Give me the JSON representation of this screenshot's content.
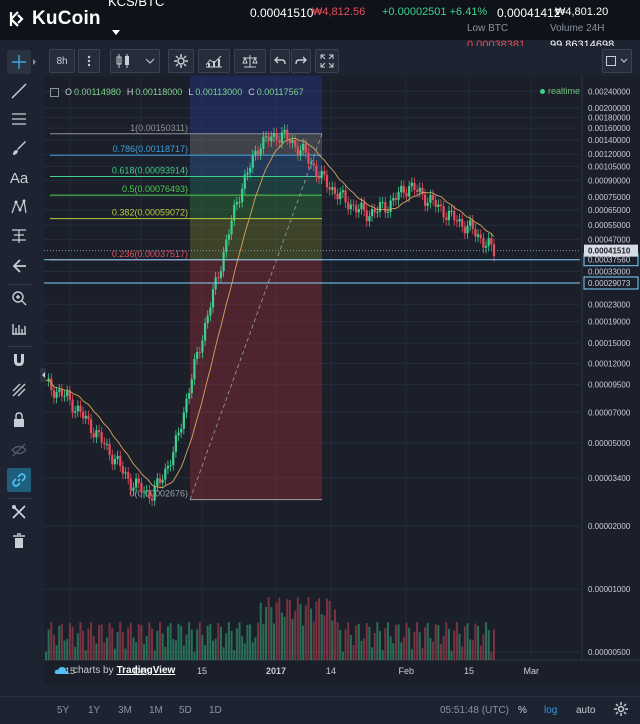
{
  "header": {
    "logo_text": "KuCoin",
    "pair": "KCS/BTC",
    "last_price": "0.00041510",
    "last_price_krw": "₩4,812.56",
    "change": "+0.00002501 +6.41%",
    "high_price": "0.00041412",
    "high_price_krw": "₩4,801.20",
    "low_label": "Low BTC",
    "low_value": "0.00038381",
    "volume_label": "Volume 24H",
    "volume_value": "99.86314698"
  },
  "toolbar": {
    "interval": "8h",
    "icons": [
      "more-icon",
      "candlestick-icon",
      "chevron-down-icon",
      "gear-icon",
      "indicators-icon",
      "compare-icon",
      "undo-icon",
      "redo-icon",
      "fullscreen-icon",
      "color-swatch-icon"
    ]
  },
  "left_tools": [
    "crosshair-icon",
    "trend-line-icon",
    "horizontal-lines-icon",
    "brush-icon",
    "text-tool",
    "pattern-icon",
    "fibonacci-icon",
    "arrow-icon",
    "zoom-icon",
    "measure-icon",
    "magnet-icon",
    "drawing-mode-icon",
    "lock-icon",
    "hide-icon",
    "link-icon",
    "tools-icon",
    "trash-icon"
  ],
  "left_tools_text": "Aa",
  "legend": {
    "o_label": "O",
    "o_value": "0.00114980",
    "h_label": "H",
    "h_value": "0.00118000",
    "l_label": "L",
    "l_value": "0.00113000",
    "c_label": "C",
    "c_value": "0.00117567",
    "realtime": "realtime"
  },
  "attribution": {
    "prefix": "charts by",
    "brand": "TradingView"
  },
  "bottom": {
    "ranges": [
      "5Y",
      "1Y",
      "3M",
      "1M",
      "5D",
      "1D"
    ],
    "time": "05:51:48 (UTC)",
    "percent": "%",
    "log": "log",
    "auto": "auto"
  },
  "colors": {
    "background": "#1a1f2a",
    "up": "#3fcf8e",
    "down": "#e84d5b",
    "accent": "#2d9cdb"
  },
  "chart_data": {
    "type": "line",
    "chart_kind": "candlestick",
    "y_scale": "log",
    "x_tick_labels": [
      "15",
      "Dec",
      "15",
      "2017",
      "14",
      "Feb",
      "15",
      "Mar"
    ],
    "y_tick_labels": [
      "0.00240000",
      "0.00200000",
      "0.00180000",
      "0.00160000",
      "0.00140000",
      "0.00120000",
      "0.00105000",
      "0.00090000",
      "0.00075000",
      "0.00065000",
      "0.00055000",
      "0.00047000",
      "0.00041510",
      "0.00037560",
      "0.00033000",
      "0.00029073",
      "0.00023000",
      "0.00019000",
      "0.00015000",
      "0.00012000",
      "0.00009500",
      "0.00007000",
      "0.00005000",
      "0.00003400",
      "0.00002000",
      "0.00001000",
      "0.00000500"
    ],
    "ylim": [
      5e-06,
      0.0026
    ],
    "series": [
      {
        "name": "KCS/BTC",
        "x": [
          "Nov 8",
          "Nov 15",
          "Nov 22",
          "Dec 1",
          "Dec 8",
          "Dec 15",
          "Dec 22",
          "Dec 29",
          "Jan 1",
          "Jan 5",
          "Jan 9",
          "Jan 12",
          "Jan 14",
          "Jan 18",
          "Jan 22",
          "Jan 26",
          "Jan 30",
          "Feb 1",
          "Feb 5",
          "Feb 10",
          "Feb 15",
          "Feb 20"
        ],
        "values": [
          9.5e-05,
          8.2e-05,
          6.2e-05,
          4.5e-05,
          3.2e-05,
          2.8e-05,
          4.5e-05,
          0.00012,
          0.0003,
          0.00075,
          0.00135,
          0.0015,
          0.00125,
          0.0009,
          0.00072,
          0.00062,
          0.00068,
          0.00085,
          0.00072,
          0.0006,
          0.00052,
          0.00041
        ]
      }
    ],
    "fibonacci": {
      "levels": [
        {
          "ratio": "1",
          "price": "0.00150311",
          "label": "1(0.00150311)",
          "color": "#8f9199"
        },
        {
          "ratio": "0.786",
          "price": "0.00118717",
          "label": "0.786(0.00118717)",
          "color": "#3f9fd8"
        },
        {
          "ratio": "0.618",
          "price": "0.00093914",
          "label": "0.618(0.00093914)",
          "color": "#3fcf8e"
        },
        {
          "ratio": "0.5",
          "price": "0.00076493",
          "label": "0.5(0.00076493)",
          "color": "#4fcf4f"
        },
        {
          "ratio": "0.382",
          "price": "0.00059072",
          "label": "0.382(0.00059072)",
          "color": "#b7cf3f"
        },
        {
          "ratio": "0.236",
          "price": "0.00037517",
          "label": "0.236(0.00037517)",
          "color": "#e84d5b"
        },
        {
          "ratio": "0",
          "price": "0.00002676",
          "label": "0(0.00002676)",
          "color": "#9aa0aa"
        }
      ]
    },
    "horizontal_lines": [
      "0.00037560",
      "0.00029073"
    ],
    "last_price_label": "0.00041510"
  }
}
